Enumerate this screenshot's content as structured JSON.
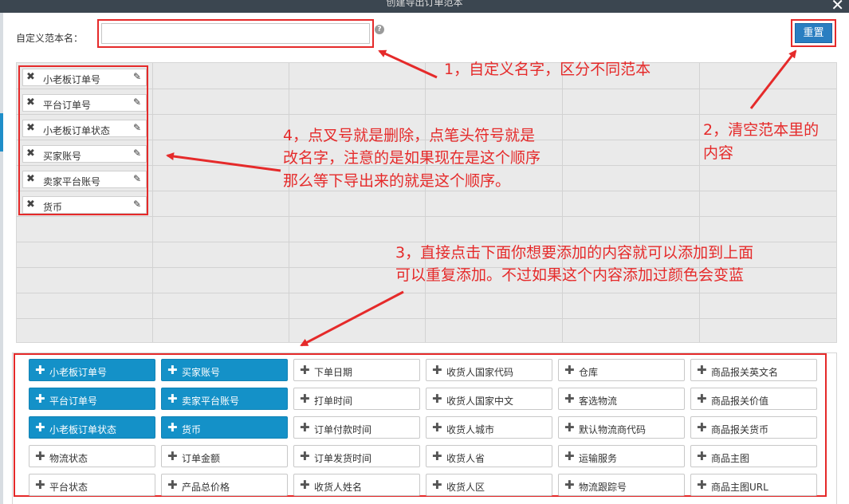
{
  "window": {
    "title": "创建导出订单范本",
    "close_glyph": "✕"
  },
  "form": {
    "name_label": "自定义范本名：",
    "name_value": "",
    "name_placeholder": "",
    "help_glyph": "?",
    "reset_label": "重置"
  },
  "template_fields": [
    {
      "label": "小老板订单号"
    },
    {
      "label": "平台订单号"
    },
    {
      "label": "小老板订单状态"
    },
    {
      "label": "买家账号"
    },
    {
      "label": "卖家平台账号"
    },
    {
      "label": "货币"
    }
  ],
  "options": [
    [
      {
        "label": "小老板订单号",
        "selected": true
      },
      {
        "label": "平台订单号",
        "selected": true
      },
      {
        "label": "小老板订单状态",
        "selected": true
      },
      {
        "label": "物流状态",
        "selected": false
      },
      {
        "label": "平台状态",
        "selected": false
      }
    ],
    [
      {
        "label": "买家账号",
        "selected": true
      },
      {
        "label": "卖家平台账号",
        "selected": true
      },
      {
        "label": "货币",
        "selected": true
      },
      {
        "label": "订单金额",
        "selected": false
      },
      {
        "label": "产品总价格",
        "selected": false
      }
    ],
    [
      {
        "label": "下单日期",
        "selected": false
      },
      {
        "label": "打单时间",
        "selected": false
      },
      {
        "label": "订单付款时间",
        "selected": false
      },
      {
        "label": "订单发货时间",
        "selected": false
      },
      {
        "label": "收货人姓名",
        "selected": false
      }
    ],
    [
      {
        "label": "收货人国家代码",
        "selected": false
      },
      {
        "label": "收货人国家中文",
        "selected": false
      },
      {
        "label": "收货人城市",
        "selected": false
      },
      {
        "label": "收货人省",
        "selected": false
      },
      {
        "label": "收货人区",
        "selected": false
      }
    ],
    [
      {
        "label": "仓库",
        "selected": false
      },
      {
        "label": "客选物流",
        "selected": false
      },
      {
        "label": "默认物流商代码",
        "selected": false
      },
      {
        "label": "运输服务",
        "selected": false
      },
      {
        "label": "物流跟踪号",
        "selected": false
      }
    ],
    [
      {
        "label": "商品报关英文名",
        "selected": false
      },
      {
        "label": "商品报关价值",
        "selected": false
      },
      {
        "label": "商品报关货币",
        "selected": false
      },
      {
        "label": "商品主图",
        "selected": false
      },
      {
        "label": "商品主图URL",
        "selected": false
      }
    ]
  ],
  "annotations": {
    "a1": "1，自定义名字，区分不同范本",
    "a2_line1": "2，清空范本里的",
    "a2_line2": "内容",
    "a3_line1": "3，直接点击下面你想要添加的内容就可以添加到上面",
    "a3_line2": "可以重复添加。不过如果这个内容添加过颜色会变蓝",
    "a4_line1": "4，点叉号就是删除，点笔头符号就是",
    "a4_line2": "改名字，注意的是如果现在是这个顺序",
    "a4_line3": "那么等下导出来的就是这个顺序。"
  },
  "colors": {
    "selected_option": "#1491c8",
    "reset_button": "#2a7ec1",
    "annotation": "#e52a2a"
  }
}
